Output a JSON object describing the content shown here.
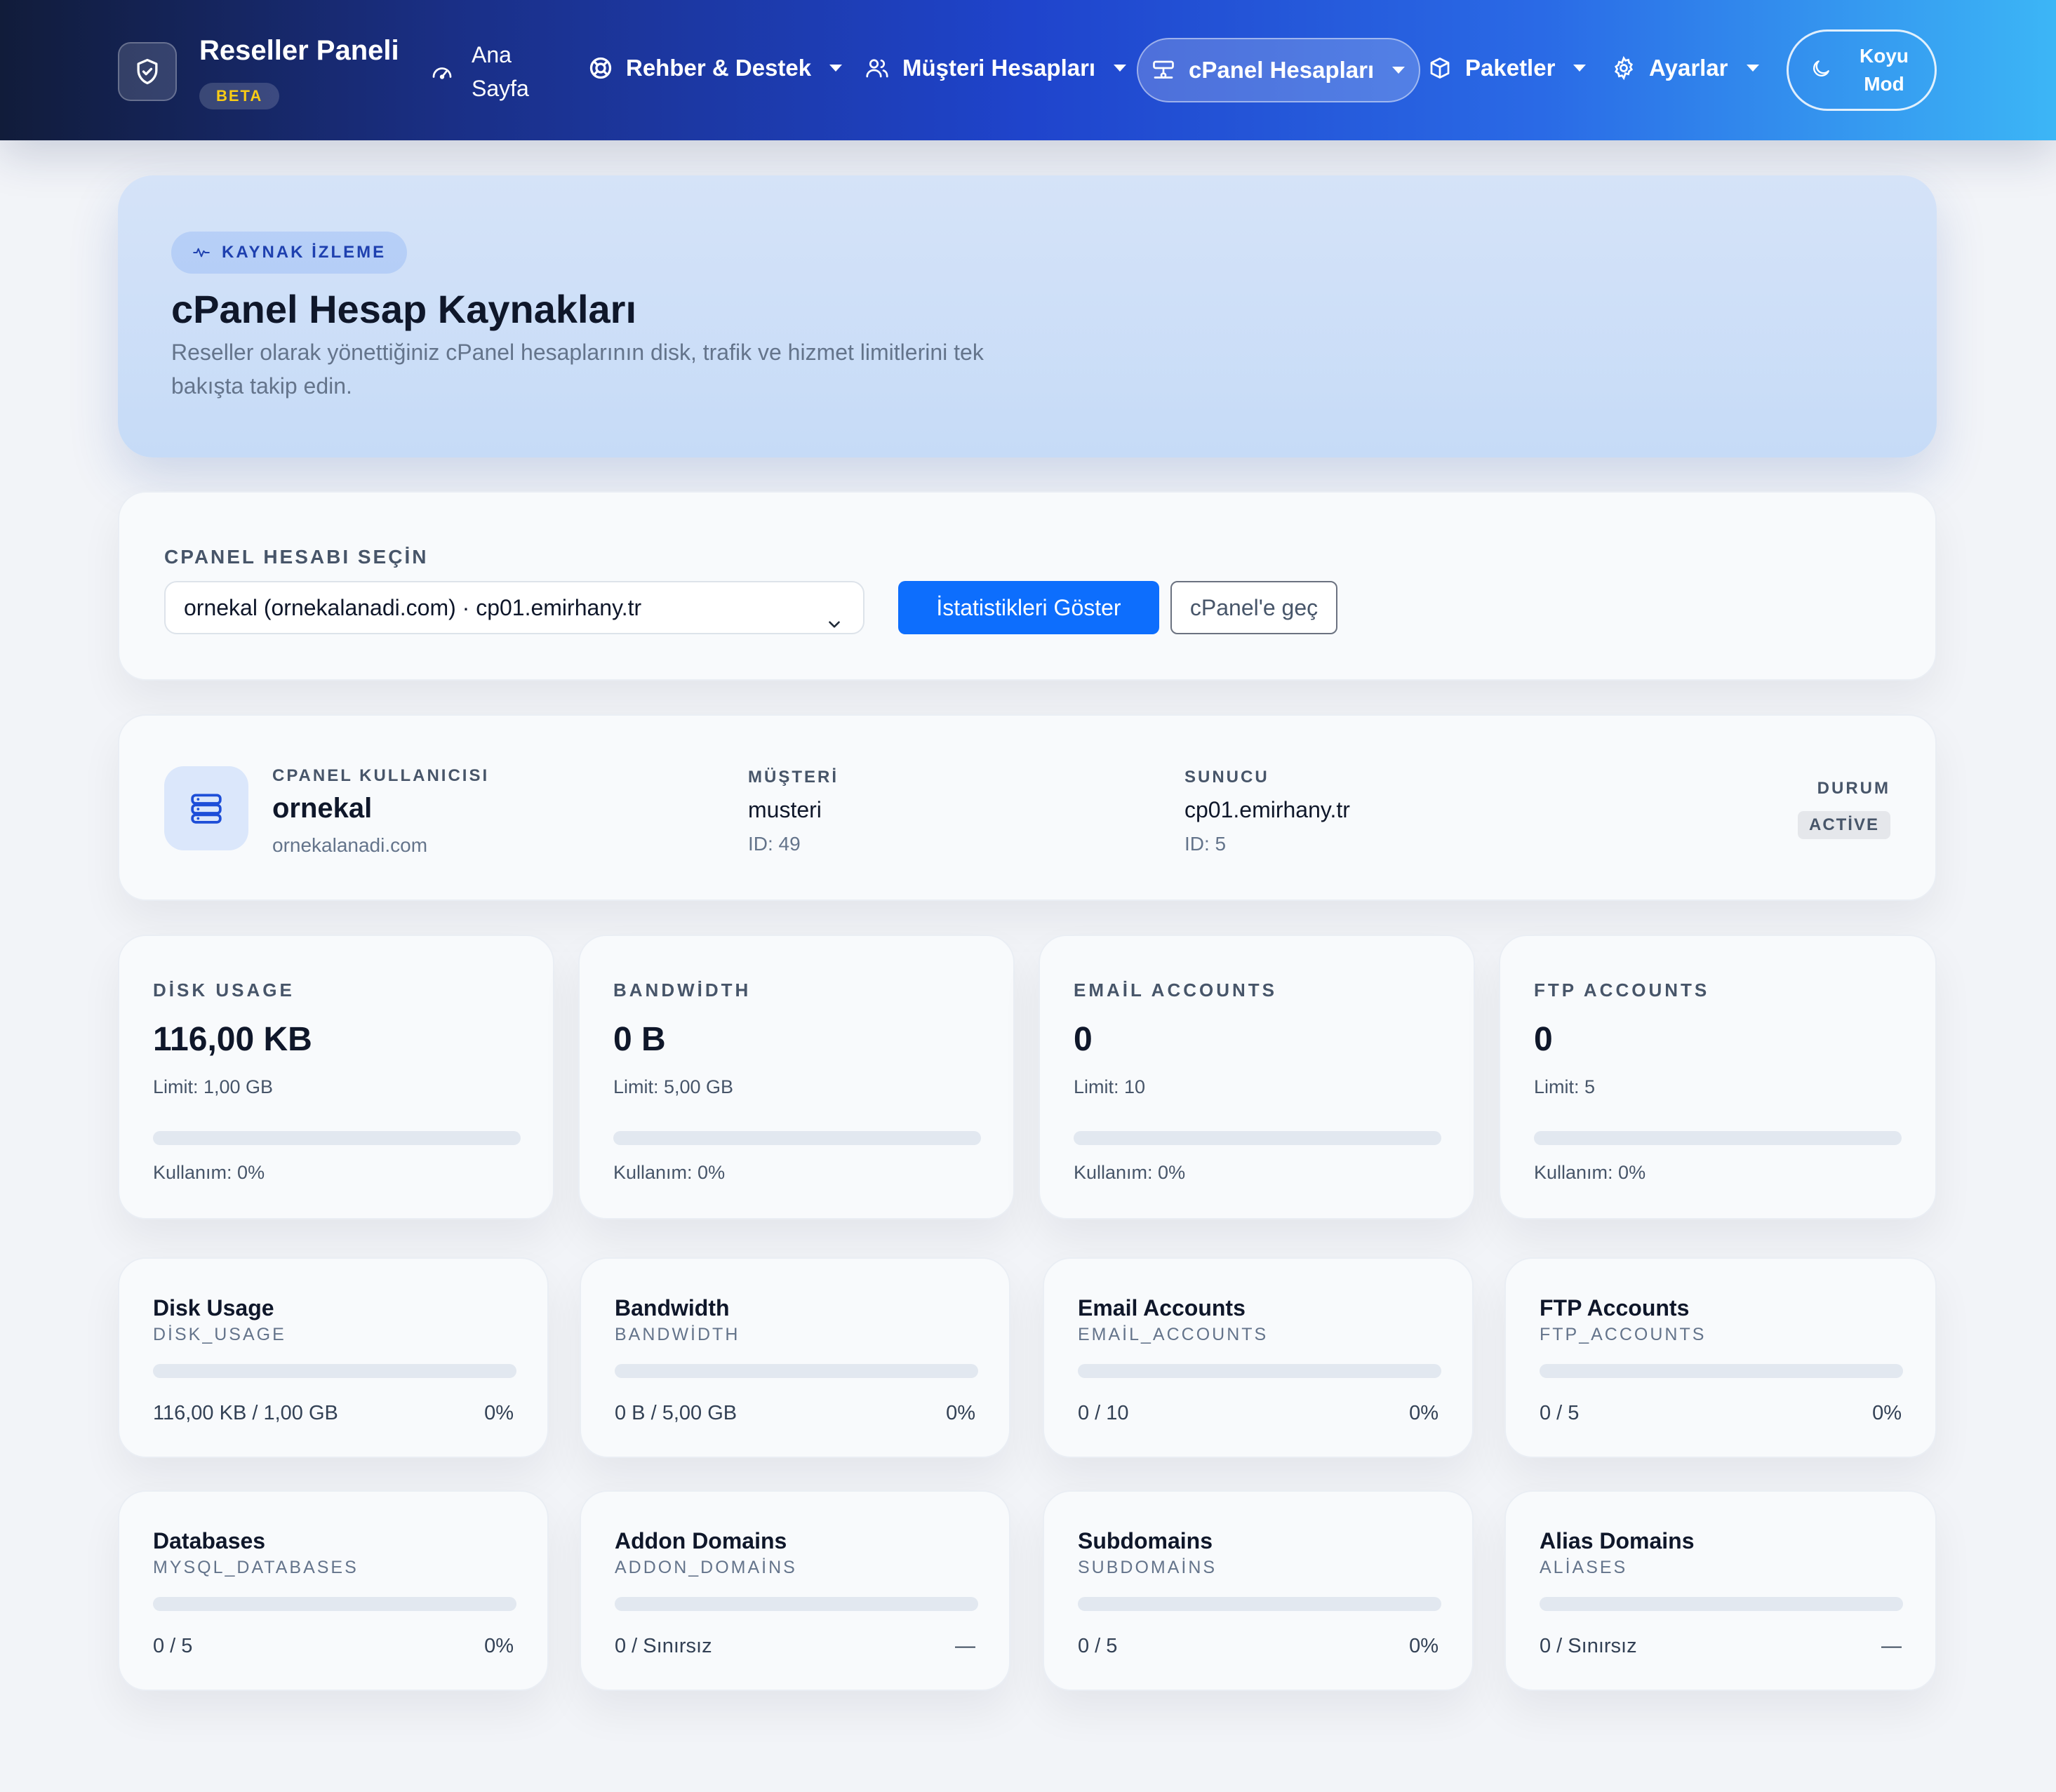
{
  "navbar": {
    "brand_title": "Reseller Paneli",
    "brand_badge": "BETA",
    "items": [
      {
        "label_line1": "Ana",
        "label_line2": "Sayfa",
        "icon": "dashboard-icon"
      },
      {
        "label": "Rehber & Destek",
        "icon": "lifebuoy-icon"
      },
      {
        "label": "Müşteri Hesapları",
        "icon": "users-icon"
      },
      {
        "label": "cPanel Hesapları",
        "icon": "server-icon",
        "active": true
      },
      {
        "label": "Paketler",
        "icon": "box-icon"
      },
      {
        "label": "Ayarlar",
        "icon": "gear-icon"
      }
    ],
    "dark_mode_line1": "Koyu",
    "dark_mode_line2": "Mod"
  },
  "hero": {
    "badge": "KAYNAK İZLEME",
    "title": "cPanel Hesap Kaynakları",
    "description": "Reseller olarak yönettiğiniz cPanel hesaplarının disk, trafik ve hizmet limitlerini tek bakışta takip edin."
  },
  "selector": {
    "label": "CPANEL HESABI SEÇİN",
    "selected_value": "ornekal (ornekalanadi.com) · cp01.emirhany.tr",
    "show_stats_button": "İstatistikleri Göster",
    "switch_button": "cPanel'e geç"
  },
  "account": {
    "user_label": "CPANEL KULLANICISI",
    "username": "ornekal",
    "domain": "ornekalanadi.com",
    "customer_label": "MÜŞTERİ",
    "customer_name": "musteri",
    "customer_id": "ID: 49",
    "server_label": "SUNUCU",
    "server_name": "cp01.emirhany.tr",
    "server_id": "ID: 5",
    "status_label": "DURUM",
    "status": "ACTİVE"
  },
  "stats": [
    {
      "label": "DİSK USAGE",
      "value": "116,00 KB",
      "limit": "Limit: 1,00 GB",
      "usage": "Kullanım: 0%",
      "percent": 0
    },
    {
      "label": "BANDWİDTH",
      "value": "0 B",
      "limit": "Limit: 5,00 GB",
      "usage": "Kullanım: 0%",
      "percent": 0
    },
    {
      "label": "EMAİL ACCOUNTS",
      "value": "0",
      "limit": "Limit: 10",
      "usage": "Kullanım: 0%",
      "percent": 0
    },
    {
      "label": "FTP ACCOUNTS",
      "value": "0",
      "limit": "Limit: 5",
      "usage": "Kullanım: 0%",
      "percent": 0
    }
  ],
  "resources": [
    {
      "title": "Disk Usage",
      "key": "DİSK_USAGE",
      "amount": "116,00 KB / 1,00 GB",
      "percent_text": "0%",
      "percent": 0
    },
    {
      "title": "Bandwidth",
      "key": "BANDWİDTH",
      "amount": "0 B / 5,00 GB",
      "percent_text": "0%",
      "percent": 0
    },
    {
      "title": "Email Accounts",
      "key": "EMAİL_ACCOUNTS",
      "amount": "0 / 10",
      "percent_text": "0%",
      "percent": 0
    },
    {
      "title": "FTP Accounts",
      "key": "FTP_ACCOUNTS",
      "amount": "0 / 5",
      "percent_text": "0%",
      "percent": 0
    },
    {
      "title": "Databases",
      "key": "MYSQL_DATABASES",
      "amount": "0 / 5",
      "percent_text": "0%",
      "percent": 0
    },
    {
      "title": "Addon Domains",
      "key": "ADDON_DOMAİNS",
      "amount": "0 / Sınırsız",
      "percent_text": "—",
      "percent": 0
    },
    {
      "title": "Subdomains",
      "key": "SUBDOMAİNS",
      "amount": "0 / 5",
      "percent_text": "0%",
      "percent": 0
    },
    {
      "title": "Alias Domains",
      "key": "ALİASES",
      "amount": "0 / Sınırsız",
      "percent_text": "—",
      "percent": 0
    }
  ],
  "colors": {
    "accent": "#0d6efd",
    "nav_gradient_start": "#111c3a",
    "nav_gradient_end": "#3cb6f6",
    "beta_badge": "#facc15"
  }
}
